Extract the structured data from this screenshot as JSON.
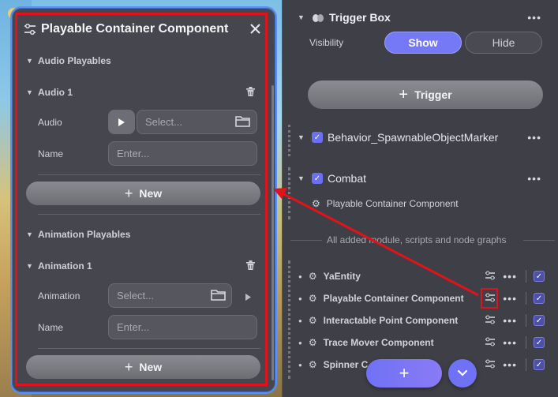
{
  "colors": {
    "accent": "#6b6ff2",
    "highlight": "#e0121b",
    "panel_border": "#5f8fe8"
  },
  "panel": {
    "title": "Playable Container Component",
    "sections": {
      "audio_playables": "Audio Playables",
      "audio_1": "Audio 1",
      "audio_label": "Audio",
      "audio_placeholder": "Select...",
      "name_label": "Name",
      "name_placeholder": "Enter...",
      "new_label": "New",
      "animation_playables": "Animation Playables",
      "animation_1": "Animation 1",
      "animation_label": "Animation",
      "animation_placeholder": "Select...",
      "name_label_2": "Name",
      "name_placeholder_2": "Enter...",
      "new_label_2": "New"
    }
  },
  "inspector": {
    "trigger_box": "Trigger Box",
    "visibility_label": "Visibility",
    "show_label": "Show",
    "hide_label": "Hide",
    "trigger_button": "Trigger",
    "behavior": "Behavior_SpawnableObjectMarker",
    "combat": "Combat",
    "combat_child": "Playable Container Component",
    "divider_text": "All added module, scripts and node graphs",
    "modules": [
      "YaEntity",
      "Playable Container Component",
      "Interactable Point Component",
      "Trace Mover Component",
      "Spinner C"
    ],
    "add_label": "+"
  }
}
